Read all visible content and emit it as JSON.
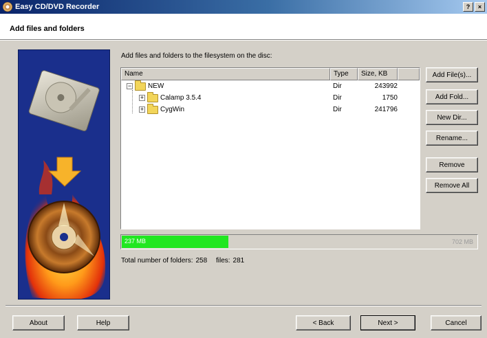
{
  "window": {
    "title": "Easy CD/DVD Recorder",
    "help_glyph": "?",
    "close_glyph": "×"
  },
  "header": {
    "title": "Add files and folders"
  },
  "main": {
    "instruction": "Add files and folders to the filesystem on the disc:",
    "columns": {
      "name": "Name",
      "type": "Type",
      "size": "Size, KB"
    },
    "rows": [
      {
        "name": "NEW",
        "type": "Dir",
        "size": "243992",
        "expander": "−"
      },
      {
        "name": "Calamp 3.5.4",
        "type": "Dir",
        "size": "1750",
        "expander": "+"
      },
      {
        "name": "CygWin",
        "type": "Dir",
        "size": "241796",
        "expander": "+"
      }
    ],
    "progress": {
      "used_label": "237 MB",
      "capacity_label": "702 MB",
      "fraction": 0.3
    },
    "totals": {
      "folders_label": "Total number of folders:",
      "folders_value": "258",
      "files_label": "files:",
      "files_value": "281"
    }
  },
  "side_buttons": {
    "add_files": "Add File(s)...",
    "add_folder": "Add Fold...",
    "new_dir": "New Dir...",
    "rename": "Rename...",
    "remove": "Remove",
    "remove_all": "Remove All"
  },
  "footer": {
    "about": "About",
    "help": "Help",
    "back": "< Back",
    "next": "Next >",
    "cancel": "Cancel"
  },
  "colors": {
    "progress_fill": "#21e721",
    "banner_bg": "#1a2f8c",
    "titlebar_start": "#0a246a",
    "titlebar_end": "#a6caf0"
  }
}
